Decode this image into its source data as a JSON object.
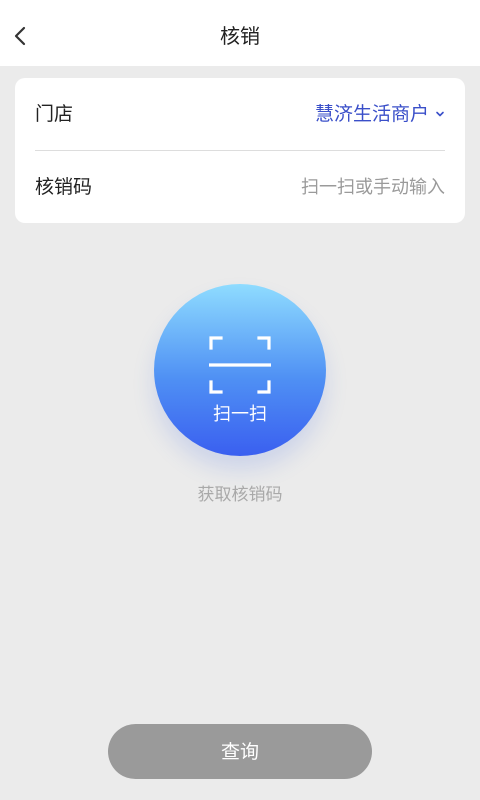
{
  "header": {
    "title": "核销"
  },
  "form": {
    "store_label": "门店",
    "store_value": "慧济生活商户",
    "code_label": "核销码",
    "code_value": "",
    "code_placeholder": "扫一扫或手动输入"
  },
  "scan": {
    "label": "扫一扫"
  },
  "hint": "获取核销码",
  "actions": {
    "query_label": "查询"
  },
  "colors": {
    "accent": "#3a4fc9",
    "scan_gradient_top": "#8fdcff",
    "scan_gradient_bottom": "#3a5ff0",
    "button_disabled": "#9a9a9a"
  }
}
